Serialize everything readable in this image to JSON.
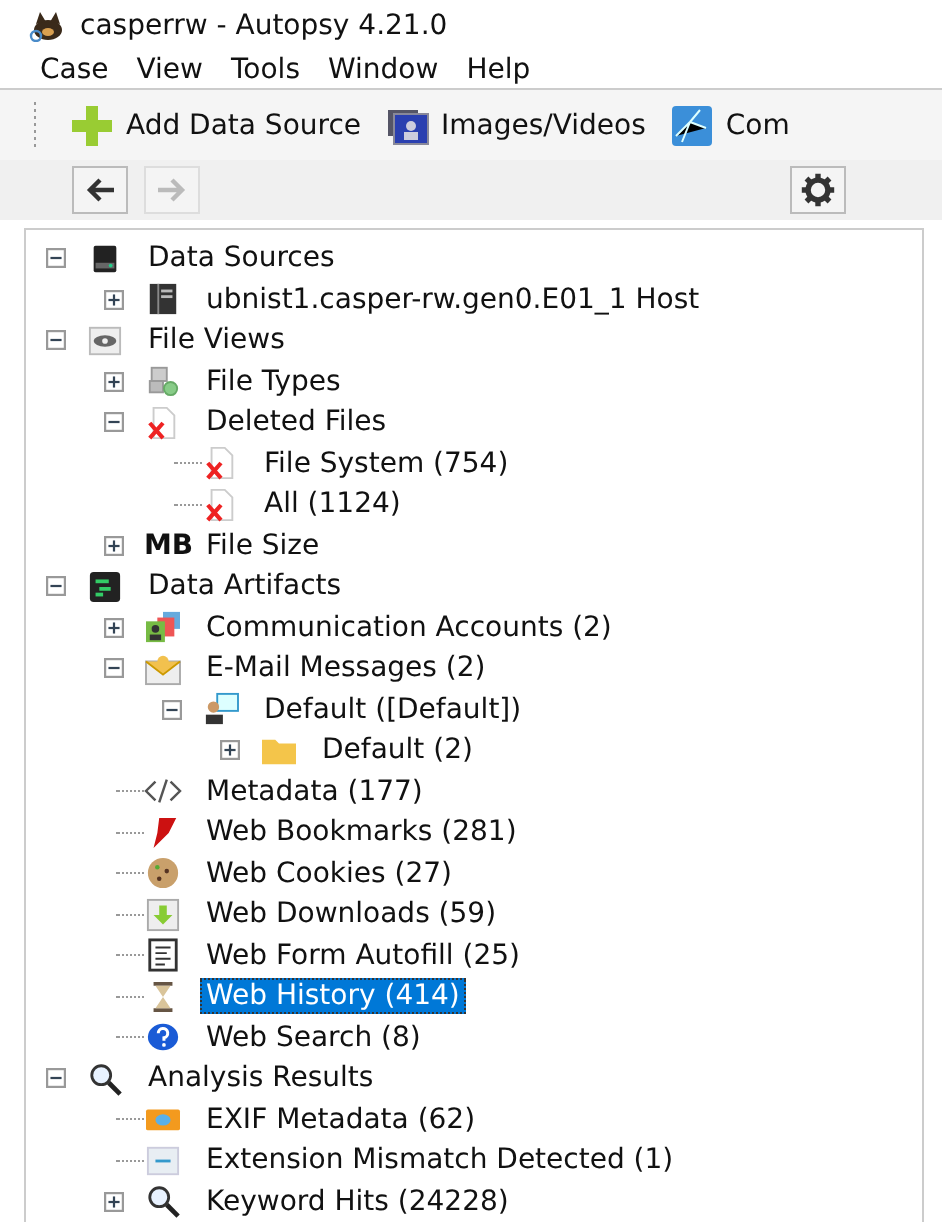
{
  "window": {
    "title": "casperrw - Autopsy 4.21.0"
  },
  "menu": [
    "Case",
    "View",
    "Tools",
    "Window",
    "Help"
  ],
  "toolbar": [
    {
      "label": "Add Data Source",
      "kind": "plus"
    },
    {
      "label": "Images/Videos",
      "kind": "images"
    },
    {
      "label": "Com",
      "kind": "network"
    }
  ],
  "nav": {
    "back_disabled": false,
    "forward_disabled": true
  },
  "tree": [
    {
      "label": "Data Sources",
      "kind": "drive",
      "expanded": true,
      "selected": false,
      "children": [
        {
          "label": "ubnist1.casper-rw.gen0.E01_1 Host",
          "kind": "server",
          "expanded": false,
          "selected": false
        }
      ]
    },
    {
      "label": "File Views",
      "kind": "eye",
      "expanded": true,
      "selected": false,
      "children": [
        {
          "label": "File Types",
          "kind": "filetypes",
          "expanded": false,
          "selected": false
        },
        {
          "label": "Deleted Files",
          "kind": "deleted",
          "expanded": true,
          "selected": false,
          "children": [
            {
              "label": "File System (754)",
              "kind": "deleted",
              "selected": false
            },
            {
              "label": "All (1124)",
              "kind": "deleted",
              "selected": false
            }
          ]
        },
        {
          "label": "File Size",
          "kind": "badge",
          "badge": "MB",
          "expanded": false,
          "selected": false
        }
      ]
    },
    {
      "label": "Data Artifacts",
      "kind": "terminal",
      "expanded": true,
      "selected": false,
      "children": [
        {
          "label": "Communication Accounts (2)",
          "kind": "contacts",
          "expanded": false,
          "selected": false
        },
        {
          "label": "E-Mail Messages (2)",
          "kind": "mail",
          "expanded": true,
          "selected": false,
          "children": [
            {
              "label": "Default ([Default])",
              "kind": "person",
              "expanded": true,
              "selected": false,
              "children": [
                {
                  "label": "Default (2)",
                  "kind": "folder",
                  "expanded": false,
                  "selected": false
                }
              ]
            }
          ]
        },
        {
          "label": "Metadata (177)",
          "kind": "code",
          "selected": false
        },
        {
          "label": "Web Bookmarks (281)",
          "kind": "bookmark",
          "selected": false
        },
        {
          "label": "Web Cookies (27)",
          "kind": "cookie",
          "selected": false
        },
        {
          "label": "Web Downloads (59)",
          "kind": "download",
          "selected": false
        },
        {
          "label": "Web Form Autofill (25)",
          "kind": "form",
          "selected": false
        },
        {
          "label": "Web History (414)",
          "kind": "hourglass",
          "selected": true
        },
        {
          "label": "Web Search (8)",
          "kind": "question",
          "selected": false
        }
      ]
    },
    {
      "label": "Analysis Results",
      "kind": "magnifier",
      "expanded": true,
      "selected": false,
      "children": [
        {
          "label": "EXIF Metadata (62)",
          "kind": "camera",
          "selected": false
        },
        {
          "label": "Extension Mismatch Detected (1)",
          "kind": "mismatch",
          "selected": false
        },
        {
          "label": "Keyword Hits (24228)",
          "kind": "magnifier-small",
          "expanded": false,
          "selected": false
        }
      ]
    }
  ]
}
